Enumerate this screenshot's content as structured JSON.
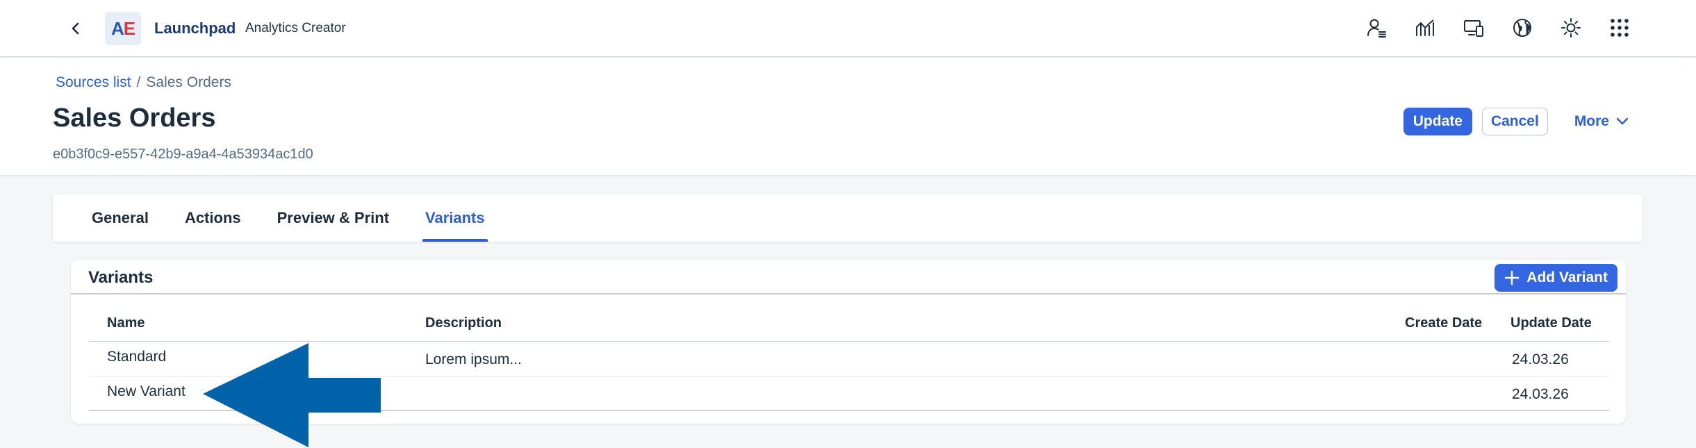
{
  "shell": {
    "logo_a": "A",
    "logo_e": "E",
    "title": "Launchpad",
    "subtitle": "Analytics Creator",
    "icons": [
      "user-settings-icon",
      "analytics-icon",
      "devices-icon",
      "globe-icon",
      "theme-icon",
      "app-grid-icon"
    ]
  },
  "header": {
    "breadcrumb_link": "Sources list",
    "breadcrumb_sep": "/",
    "breadcrumb_current": "Sales Orders",
    "title": "Sales Orders",
    "id": "e0b3f0c9-e557-42b9-a9a4-4a53934ac1d0",
    "update_label": "Update",
    "cancel_label": "Cancel",
    "more_label": "More"
  },
  "tabs": [
    {
      "label": "General",
      "active": false
    },
    {
      "label": "Actions",
      "active": false
    },
    {
      "label": "Preview & Print",
      "active": false
    },
    {
      "label": "Variants",
      "active": true
    }
  ],
  "variants": {
    "title": "Variants",
    "add_label": "Add Variant",
    "columns": {
      "name": "Name",
      "description": "Description",
      "create_date": "Create Date",
      "update_date": "Update Date"
    },
    "rows": [
      {
        "name": "Standard",
        "description": "Lorem ipsum...",
        "create_date": "",
        "update_date": "24.03.26"
      },
      {
        "name": "New Variant",
        "description": "",
        "create_date": "",
        "update_date": "24.03.26"
      }
    ]
  },
  "colors": {
    "accent": "#2c5fd6",
    "primary_button": "#3366e0",
    "annotation_arrow": "#0062a8"
  }
}
